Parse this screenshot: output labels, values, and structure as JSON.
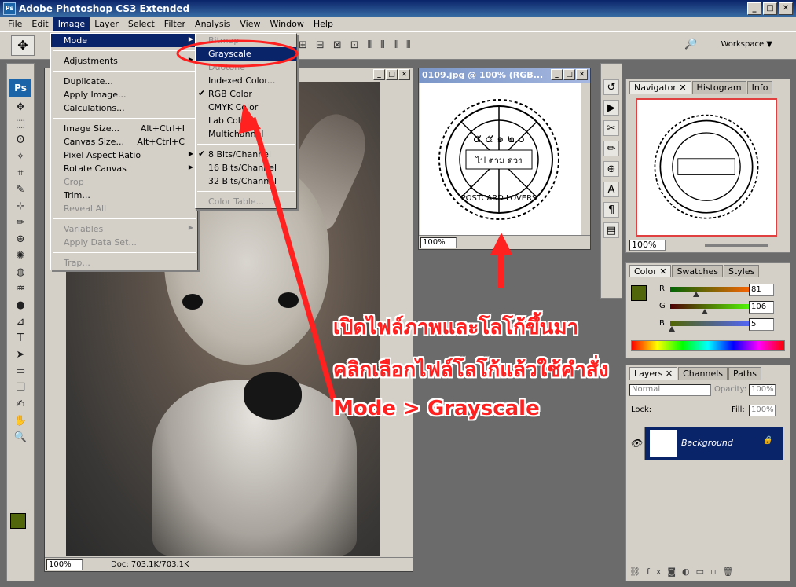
{
  "app": {
    "title": "Adobe Photoshop CS3 Extended",
    "icon_label": "Ps",
    "window_buttons": [
      "_",
      "□",
      "✕"
    ]
  },
  "menubar": [
    "File",
    "Edit",
    "Image",
    "Layer",
    "Select",
    "Filter",
    "Analysis",
    "View",
    "Window",
    "Help"
  ],
  "options": {
    "workspace_label": "Workspace ▼",
    "align_icons": [
      "⊞",
      "⊟",
      "⊠",
      "⊡",
      "⫴",
      "⫴",
      "⫴",
      "⫴"
    ]
  },
  "tools": {
    "ps_label": "Ps",
    "icons": [
      "✥",
      "⬚",
      "ʘ",
      "✧",
      "⌗",
      "✎",
      "⊹",
      "✏",
      "⊕",
      "✺",
      "◍",
      "♒",
      "●",
      "⊿",
      "T",
      "➤",
      "▭",
      "❐",
      "✍",
      "✋",
      "🔍"
    ],
    "fg_color": "#51650a",
    "bg_color": "#ffffff"
  },
  "image_menu": {
    "items": [
      {
        "label": "Mode",
        "type": "submenu",
        "highlight": true
      },
      {
        "type": "sep"
      },
      {
        "label": "Adjustments",
        "type": "submenu"
      },
      {
        "type": "sep"
      },
      {
        "label": "Duplicate...",
        "type": "item"
      },
      {
        "label": "Apply Image...",
        "type": "item"
      },
      {
        "label": "Calculations...",
        "type": "item"
      },
      {
        "type": "sep"
      },
      {
        "label": "Image Size...",
        "shortcut": "Alt+Ctrl+I",
        "type": "item"
      },
      {
        "label": "Canvas Size...",
        "shortcut": "Alt+Ctrl+C",
        "type": "item"
      },
      {
        "label": "Pixel Aspect Ratio",
        "type": "submenu"
      },
      {
        "label": "Rotate Canvas",
        "type": "submenu"
      },
      {
        "label": "Crop",
        "type": "item",
        "disabled": true
      },
      {
        "label": "Trim...",
        "type": "item"
      },
      {
        "label": "Reveal All",
        "type": "item",
        "disabled": true
      },
      {
        "type": "sep"
      },
      {
        "label": "Variables",
        "type": "submenu",
        "disabled": true
      },
      {
        "label": "Apply Data Set...",
        "type": "item",
        "disabled": true
      },
      {
        "type": "sep"
      },
      {
        "label": "Trap...",
        "type": "item",
        "disabled": true
      }
    ]
  },
  "mode_menu": {
    "items": [
      {
        "label": "Bitmap",
        "disabled": true
      },
      {
        "label": "Grayscale",
        "highlight": true
      },
      {
        "label": "Duotone",
        "disabled": true
      },
      {
        "label": "Indexed Color..."
      },
      {
        "label": "RGB Color",
        "checked": true
      },
      {
        "label": "CMYK Color"
      },
      {
        "label": "Lab Color"
      },
      {
        "label": "Multichannel"
      },
      {
        "type": "sep"
      },
      {
        "label": "8 Bits/Channel",
        "checked": true
      },
      {
        "label": "16 Bits/Channel"
      },
      {
        "label": "32 Bits/Channel"
      },
      {
        "type": "sep"
      },
      {
        "label": "Color Table...",
        "disabled": true
      }
    ]
  },
  "doc_dog": {
    "zoom": "100%",
    "doc_info": "Doc: 703.1K/703.1K"
  },
  "doc_logo": {
    "title": "0109.jpg @ 100% (RGB...",
    "zoom": "100%"
  },
  "stamp": {
    "top_text": "๕ ๕ ๑ ๒ ๐",
    "center_text": "ไป ตาม ดวง",
    "bottom_text": "POSTCARD LOVERS"
  },
  "navigator": {
    "tabs": [
      "Navigator",
      "Histogram",
      "Info"
    ],
    "zoom": "100%"
  },
  "color_panel": {
    "tabs": [
      "Color",
      "Swatches",
      "Styles"
    ],
    "channels": [
      {
        "name": "R",
        "value": "81",
        "fraction": 0.32
      },
      {
        "name": "G",
        "value": "106",
        "fraction": 0.42
      },
      {
        "name": "B",
        "value": "5",
        "fraction": 0.02
      }
    ],
    "fg": "#51650a"
  },
  "layers_panel": {
    "tabs": [
      "Layers",
      "Channels",
      "Paths"
    ],
    "blend_mode": "Normal",
    "opacity_label": "Opacity:",
    "opacity": "100%",
    "lock_label": "Lock:",
    "fill_label": "Fill:",
    "fill": "100%",
    "layer_name": "Background"
  },
  "annotations": {
    "line1": "เปิดไฟล์ภาพและโลโก้ขึ้นมา",
    "line2": "คลิกเลือกไฟล์โลโก้แล้วใช้คำสั่ง",
    "line3": "Mode > Grayscale"
  }
}
